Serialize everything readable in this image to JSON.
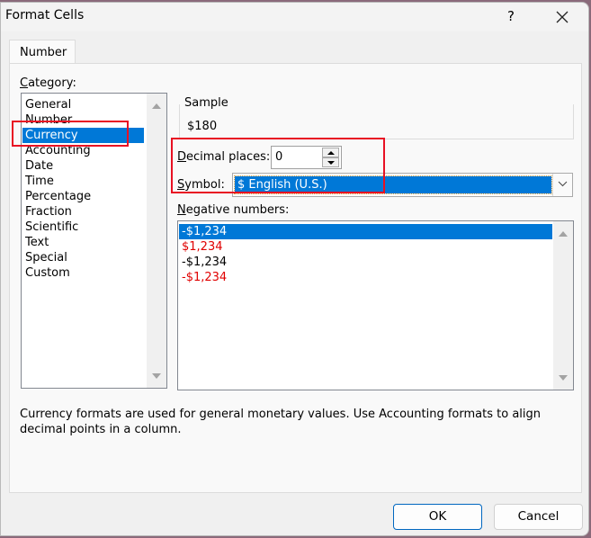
{
  "window": {
    "title": "Format Cells",
    "help_label": "?",
    "close_icon": "close-icon"
  },
  "tabs": [
    {
      "label": "Number",
      "active": true
    }
  ],
  "category": {
    "label": "Category:",
    "items": [
      "General",
      "Number",
      "Currency",
      "Accounting",
      "Date",
      "Time",
      "Percentage",
      "Fraction",
      "Scientific",
      "Text",
      "Special",
      "Custom"
    ],
    "selected": "Currency"
  },
  "sample": {
    "label": "Sample",
    "value": "$180"
  },
  "decimal_places": {
    "label": "Decimal places:",
    "value": "0"
  },
  "symbol": {
    "label": "Symbol:",
    "value": "$ English (U.S.)"
  },
  "negative_numbers": {
    "label": "Negative numbers:",
    "items": [
      {
        "text": "-$1,234",
        "color": "#000000",
        "selected": true
      },
      {
        "text": "$1,234",
        "color": "#e00000",
        "selected": false
      },
      {
        "text": "-$1,234",
        "color": "#000000",
        "selected": false
      },
      {
        "text": "-$1,234",
        "color": "#e00000",
        "selected": false
      }
    ]
  },
  "description": "Currency formats are used for general monetary values.  Use Accounting formats to align decimal points in a column.",
  "buttons": {
    "ok": "OK",
    "cancel": "Cancel"
  },
  "highlight_color": "#e81123",
  "accent_color": "#0078d7"
}
